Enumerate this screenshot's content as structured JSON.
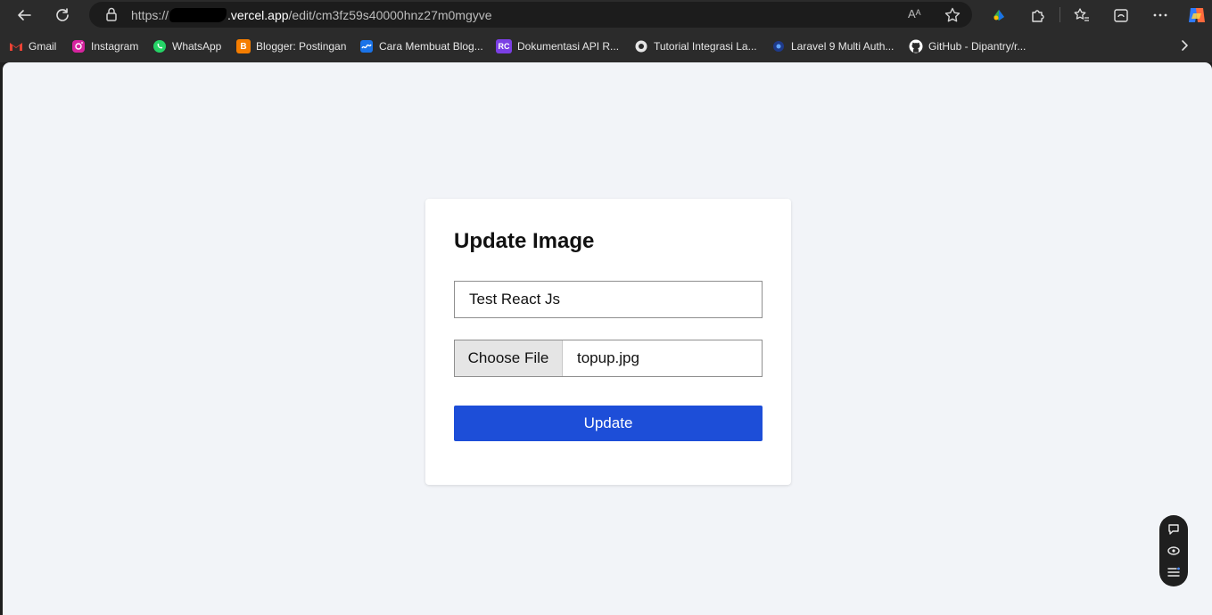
{
  "browser": {
    "url": {
      "scheme": "https://",
      "host": ".vercel.app",
      "path": "/edit/cm3fz59s40000hnz27m0mgyve"
    },
    "read_aloud_label": "Aᴬ"
  },
  "bookmarks": [
    {
      "label": "Gmail",
      "icon": "gmail-icon",
      "color": "#ea4335"
    },
    {
      "label": "Instagram",
      "icon": "instagram-icon",
      "color": "#d6249f"
    },
    {
      "label": "WhatsApp",
      "icon": "whatsapp-icon",
      "color": "#25d366"
    },
    {
      "label": "Blogger: Postingan",
      "icon": "blogger-icon",
      "color": "#f57d00"
    },
    {
      "label": "Cara Membuat Blog...",
      "icon": "blog-icon",
      "color": "#1a73e8"
    },
    {
      "label": "Dokumentasi API R...",
      "icon": "rc-icon",
      "color": "#7b3fe4"
    },
    {
      "label": "Tutorial Integrasi La...",
      "icon": "tutorial-icon",
      "color": "#e6e6e6"
    },
    {
      "label": "Laravel 9 Multi Auth...",
      "icon": "laravel-icon",
      "color": "#3b82f6"
    },
    {
      "label": "GitHub - Dipantry/r...",
      "icon": "github-icon",
      "color": "#ffffff"
    }
  ],
  "bookmark_icon_text": {
    "blogger": "B",
    "rc": "RC"
  },
  "form": {
    "title": "Update Image",
    "name_value": "Test React Js",
    "file_button": "Choose File",
    "file_name": "topup.jpg",
    "submit_label": "Update"
  },
  "colors": {
    "page_bg": "#f2f4f8",
    "card_bg": "#ffffff",
    "primary": "#1d4ed8",
    "browser_chrome": "#2b2b2b"
  }
}
